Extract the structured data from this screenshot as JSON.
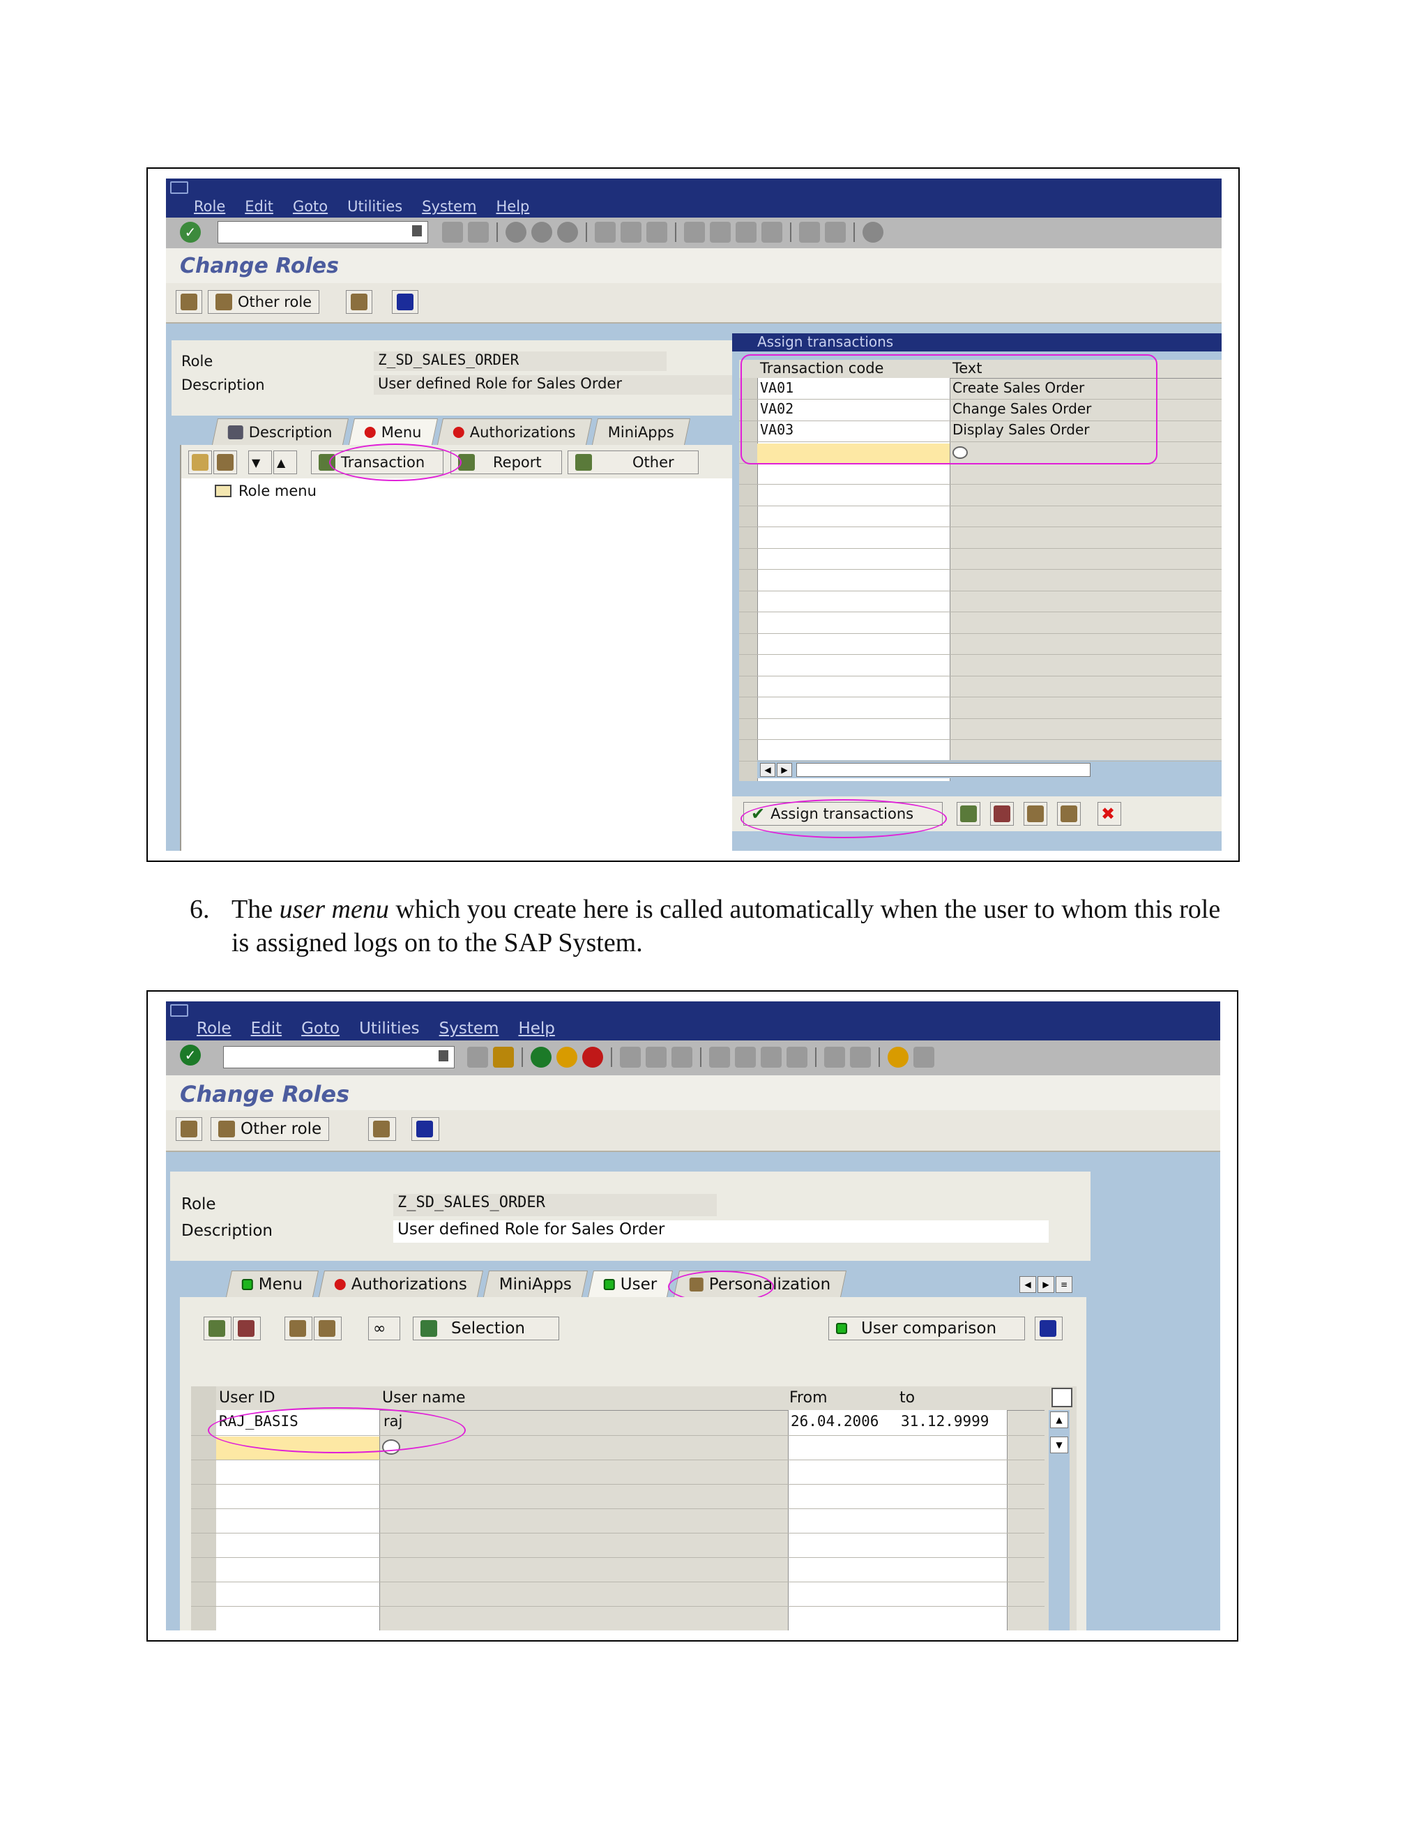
{
  "menu": [
    "Role",
    "Edit",
    "Goto",
    "Utilities",
    "System",
    "Help"
  ],
  "screen_title": "Change Roles",
  "apptoolbar": {
    "other_role": "Other role"
  },
  "fields": {
    "role_label": "Role",
    "role_value": "Z_SD_SALES_ORDER",
    "desc_label": "Description",
    "desc_value": "User defined Role for Sales Order"
  },
  "screen1": {
    "tabs": [
      "Description",
      "Menu",
      "Authorizations",
      "MiniApps"
    ],
    "menu_buttons": {
      "transaction": "Transaction",
      "report": "Report",
      "other": "Other"
    },
    "tree_root": "Role menu",
    "dialog": {
      "title": "Assign transactions",
      "col_code": "Transaction code",
      "col_text": "Text",
      "rows": [
        {
          "code": "VA01",
          "text": "Create Sales Order"
        },
        {
          "code": "VA02",
          "text": "Change Sales Order"
        },
        {
          "code": "VA03",
          "text": "Display Sales Order"
        }
      ],
      "assign_button": "Assign transactions"
    }
  },
  "caption": {
    "number": "6.",
    "before": "The ",
    "italic": "user menu",
    "after": " which you create here is called automatically when the user to whom this role is assigned logs on to the SAP System."
  },
  "screen2": {
    "tabs": [
      "Menu",
      "Authorizations",
      "MiniApps",
      "User",
      "Personalization"
    ],
    "selection_button": "Selection",
    "user_comparison_button": "User comparison",
    "table": {
      "col_userid": "User ID",
      "col_username": "User name",
      "col_from": "From",
      "col_to": "to",
      "rows": [
        {
          "userid": "RAJ_BASIS",
          "username": "raj",
          "from": "26.04.2006",
          "to": "31.12.9999"
        }
      ]
    }
  },
  "colors": {
    "titlebar": "#1e2f7a",
    "annotation": "#e020d8",
    "background": "#aec6dc"
  }
}
